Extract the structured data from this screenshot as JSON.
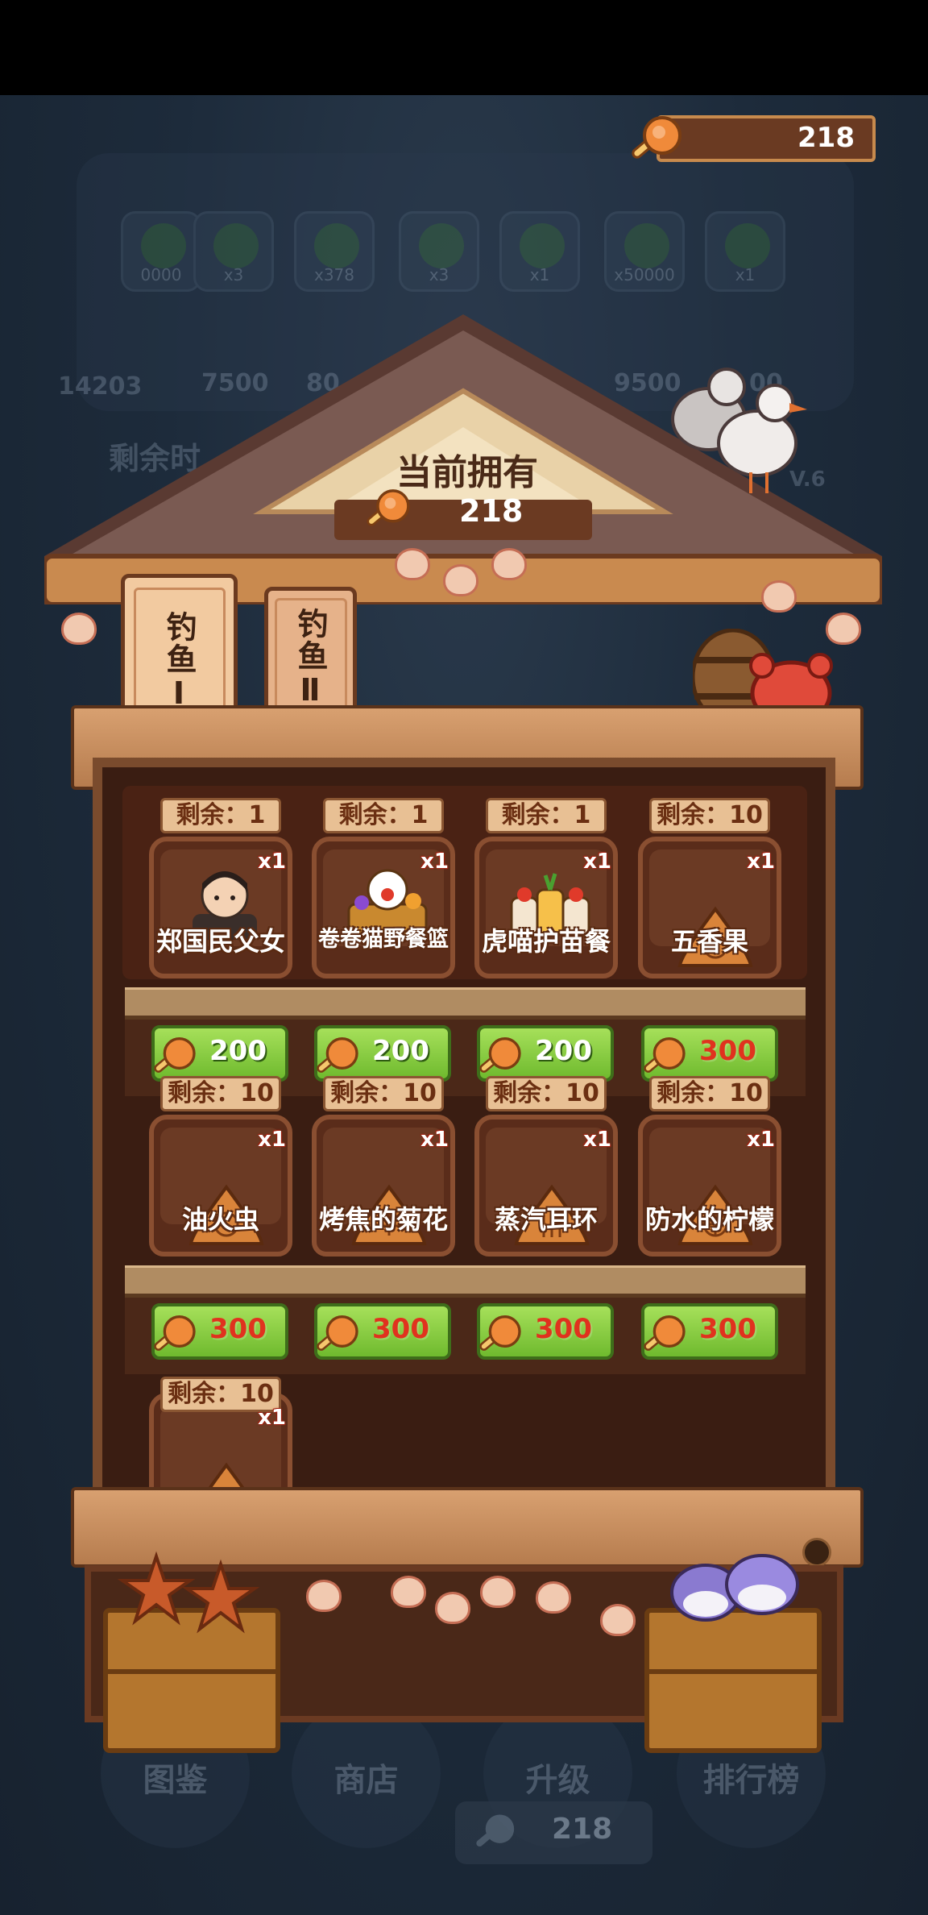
{
  "currency": {
    "top_amount": "218",
    "icon": "drumstick-icon"
  },
  "background": {
    "chips": [
      "0000",
      "x3",
      "x378",
      "x3",
      "x1",
      "x50000",
      "x1"
    ],
    "progress_numbers": [
      "14203",
      "7500",
      "80",
      "9500",
      "00"
    ],
    "left_text": "剩余时",
    "version": "V.6",
    "nav": [
      "图鉴",
      "商店",
      "升级",
      "排行榜"
    ],
    "bottom_amount": "218"
  },
  "shop": {
    "owned_title": "当前拥有",
    "owned_amount": "218",
    "tabs": [
      {
        "label": "钓鱼Ⅰ",
        "active": true
      },
      {
        "label": "钓鱼Ⅱ",
        "active": false
      }
    ],
    "items": [
      {
        "remaining": "剩余：1",
        "qty": "x1",
        "name": "郑国民父女",
        "price": "200",
        "price_color": "#ffffff",
        "art": "avatar"
      },
      {
        "remaining": "剩余：1",
        "qty": "x1",
        "name": "卷卷猫野餐篮",
        "price": "200",
        "price_color": "#ffffff",
        "art": "basket"
      },
      {
        "remaining": "剩余：1",
        "qty": "x1",
        "name": "虎喵护苗餐",
        "price": "200",
        "price_color": "#ffffff",
        "art": "meal"
      },
      {
        "remaining": "剩余：10",
        "qty": "x1",
        "name": "五香果",
        "price": "300",
        "price_color": "#e0321e",
        "art": "seed"
      },
      {
        "remaining": "剩余：10",
        "qty": "x1",
        "name": "油火虫",
        "price": "300",
        "price_color": "#e0321e",
        "art": "seed"
      },
      {
        "remaining": "剩余：10",
        "qty": "x1",
        "name": "烤焦的菊花",
        "price": "300",
        "price_color": "#e0321e",
        "art": "seed"
      },
      {
        "remaining": "剩余：10",
        "qty": "x1",
        "name": "蒸汽耳环",
        "price": "300",
        "price_color": "#e0321e",
        "art": "seed"
      },
      {
        "remaining": "剩余：10",
        "qty": "x1",
        "name": "防水的柠檬",
        "price": "300",
        "price_color": "#e0321e",
        "art": "seed"
      },
      {
        "remaining": "剩余：10",
        "qty": "x1",
        "name": "",
        "price": "",
        "art": "seed"
      }
    ]
  },
  "colors": {
    "wood_dark": "#3a1d12",
    "wood_mid": "#7a4b2d",
    "button_green": "#7cc23a",
    "price_red": "#e0321e"
  }
}
